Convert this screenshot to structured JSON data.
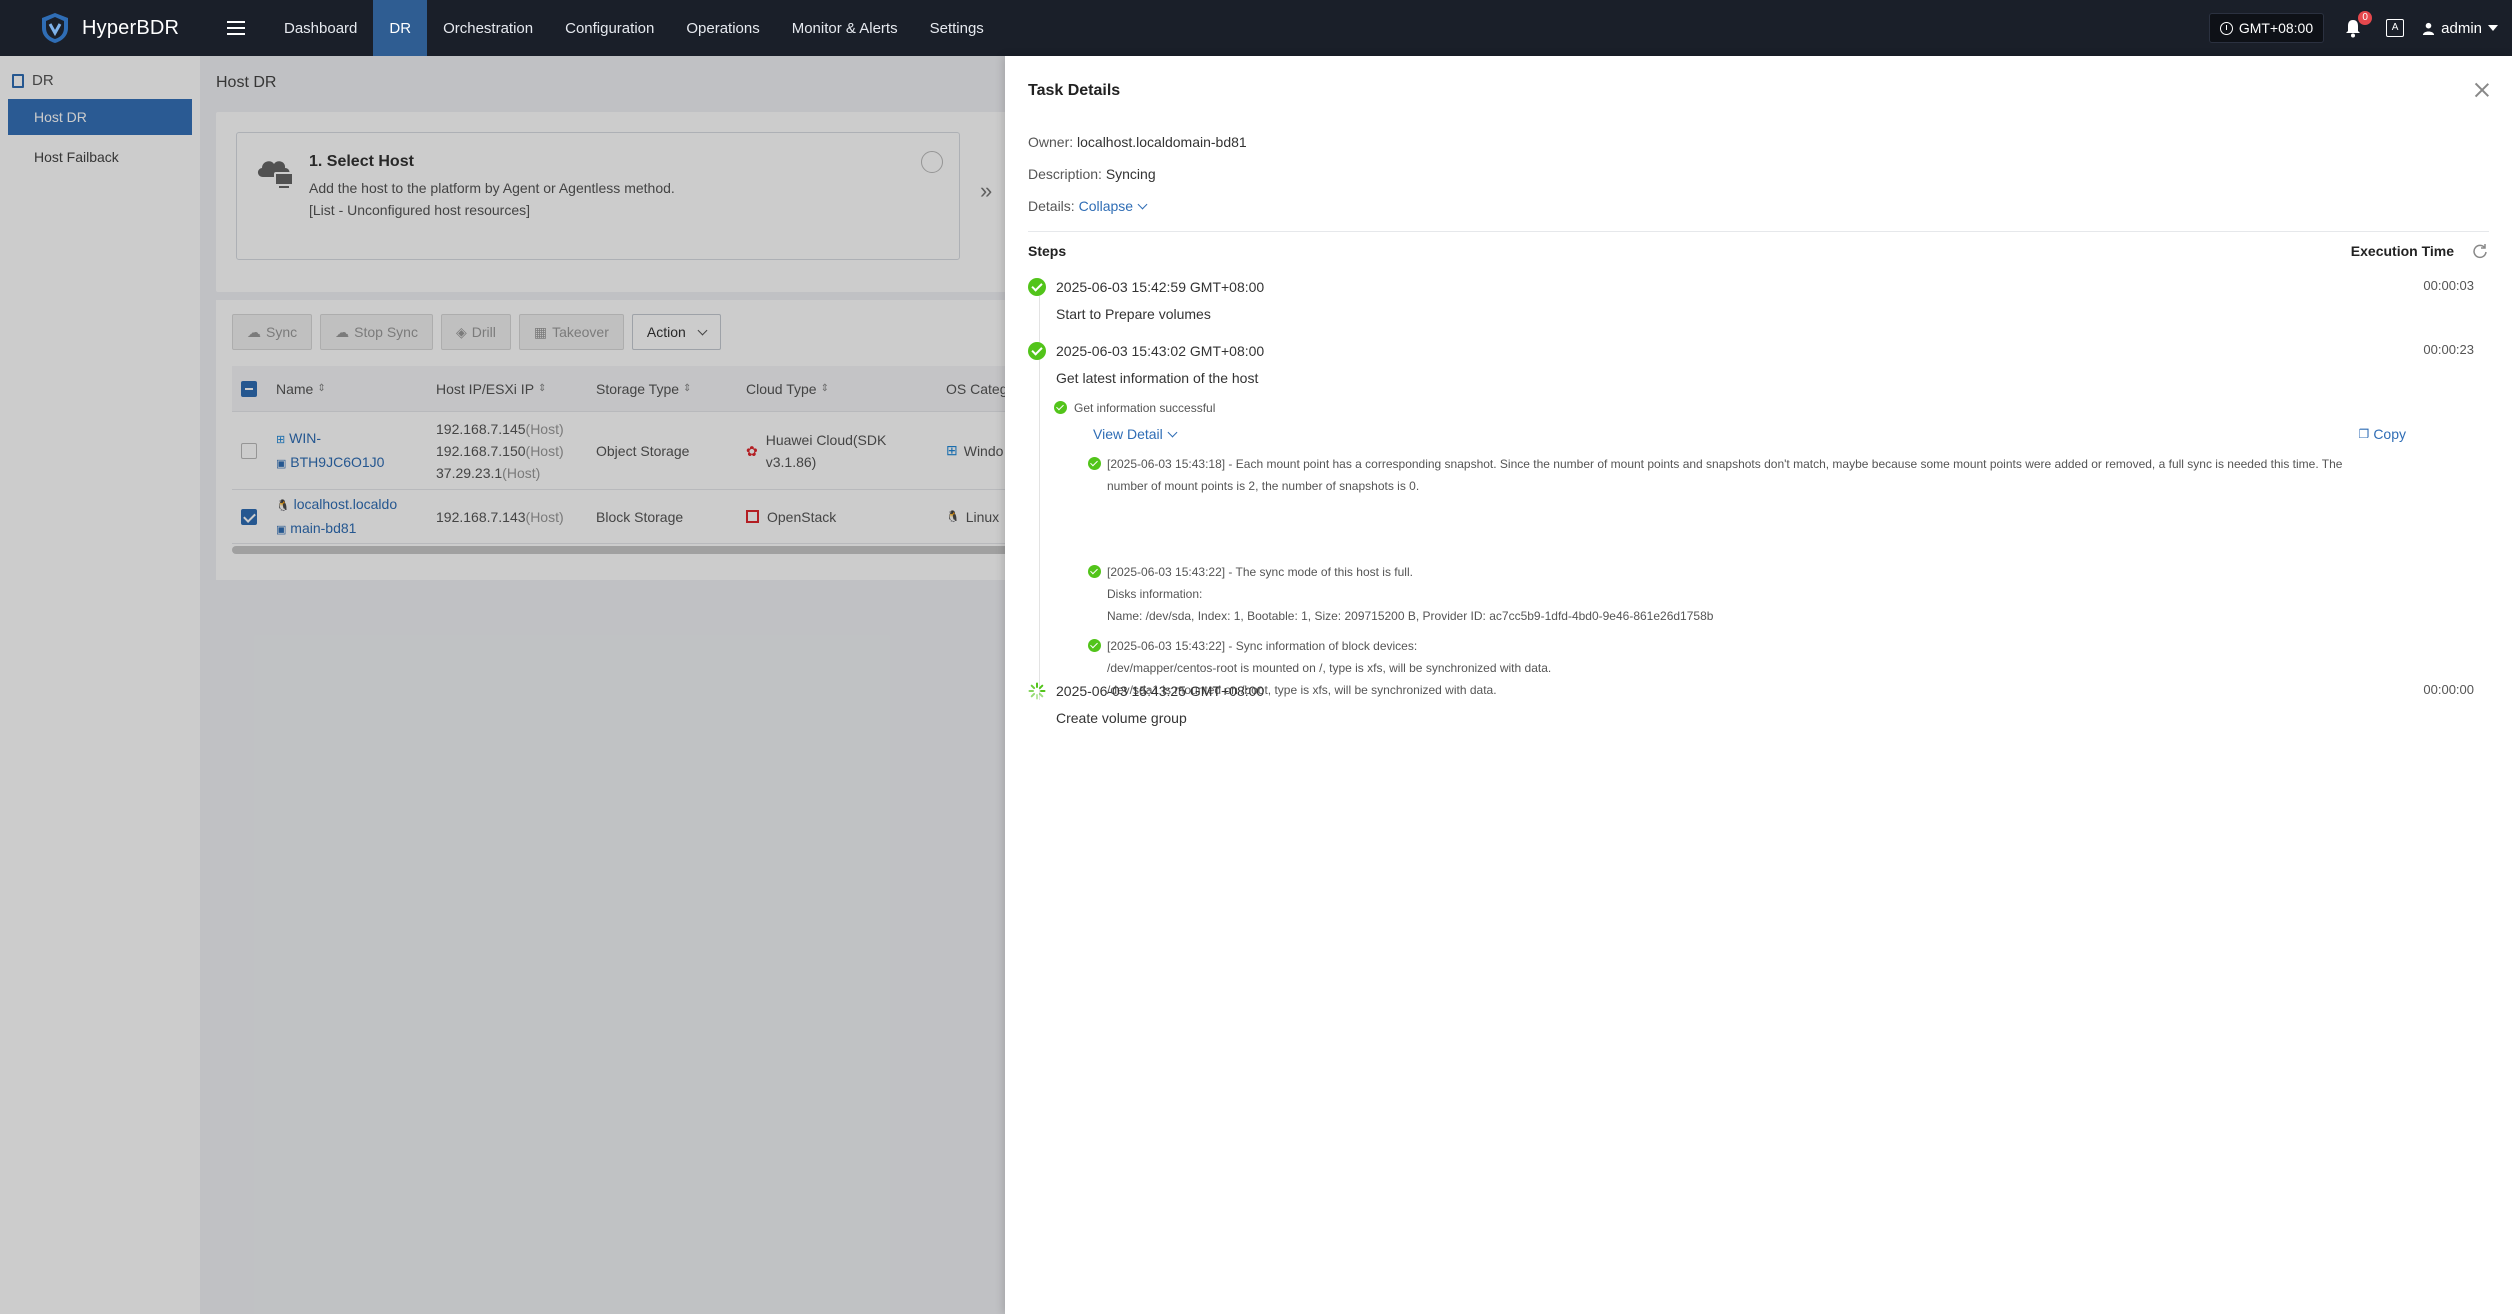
{
  "app": {
    "name": "HyperBDR"
  },
  "nav": {
    "items": [
      {
        "label": "Dashboard"
      },
      {
        "label": "DR"
      },
      {
        "label": "Orchestration"
      },
      {
        "label": "Configuration"
      },
      {
        "label": "Operations"
      },
      {
        "label": "Monitor & Alerts"
      },
      {
        "label": "Settings"
      }
    ],
    "active": "DR"
  },
  "header": {
    "timezone": "GMT+08:00",
    "notification_count": "0",
    "user": "admin"
  },
  "sidebar": {
    "section": "DR",
    "items": [
      {
        "label": "Host DR",
        "active": true
      },
      {
        "label": "Host Failback",
        "active": false
      }
    ]
  },
  "main": {
    "title": "Host DR",
    "step": {
      "title": "1. Select Host",
      "desc1": "Add the host to the platform by Agent or Agentless method.",
      "desc2": "[List - Unconfigured host resources]"
    },
    "toolbar": {
      "sync": "Sync",
      "stop_sync": "Stop Sync",
      "drill": "Drill",
      "takeover": "Takeover",
      "action": "Action"
    },
    "table": {
      "columns": [
        "Name",
        "Host IP/ESXi IP",
        "Storage Type",
        "Cloud Type",
        "OS Categ"
      ],
      "rows": [
        {
          "name1": "WIN-",
          "name2": "BTH9JC6O1J0",
          "ip1": "192.168.7.145",
          "ip2": "192.168.7.150",
          "ip3": "37.29.23.1",
          "ip_tag": "(Host)",
          "storage": "Object Storage",
          "cloud1": "Huawei Cloud(SDK",
          "cloud2": "v3.1.86)",
          "os": "Windo"
        },
        {
          "name1": "localhost.localdo",
          "name2": "main-bd81",
          "ip1": "192.168.7.143",
          "ip_tag": "(Host)",
          "storage": "Block Storage",
          "cloud1": "OpenStack",
          "os": "Linux"
        }
      ]
    }
  },
  "drawer": {
    "title": "Task Details",
    "owner_label": "Owner:",
    "owner": "localhost.localdomain-bd81",
    "description_label": "Description:",
    "description": "Syncing",
    "details_label": "Details:",
    "details_toggle": "Collapse",
    "steps_header": "Steps",
    "exec_header": "Execution Time",
    "steps": [
      {
        "time": "2025-06-03 15:42:59 GMT+08:00",
        "name": "Start to Prepare volumes",
        "duration": "00:00:03",
        "status": "done"
      },
      {
        "time": "2025-06-03 15:43:02 GMT+08:00",
        "name": "Get latest information of the host",
        "duration": "00:00:23",
        "status": "done",
        "sub": "Get information successful",
        "view_detail": "View Detail",
        "copy": "Copy",
        "details": [
          {
            "line1": "[2025-06-03 15:43:18] - Each mount point has a corresponding snapshot. Since the number of mount points and snapshots don't match, maybe because some mount points were added or removed, a full sync is needed this time. The",
            "line2": "number of mount points is 2, the number of snapshots is 0."
          },
          {
            "line1": "[2025-06-03 15:43:22] - The sync mode of this host is full.",
            "line2": "Disks information:",
            "line3": "Name: /dev/sda, Index: 1, Bootable: 1, Size: 209715200 B, Provider ID: ac7cc5b9-1dfd-4bd0-9e46-861e26d1758b"
          },
          {
            "line1": "[2025-06-03 15:43:22] - Sync information of block devices:",
            "line2": "/dev/mapper/centos-root is mounted on /, type is xfs, will be synchronized with data.",
            "line3": "/dev/sda1 is mounted on /boot, type is xfs, will be synchronized with data."
          }
        ]
      },
      {
        "time": "2025-06-03 15:43:25 GMT+08:00",
        "name": "Create volume group",
        "duration": "00:00:00",
        "status": "running"
      }
    ]
  }
}
